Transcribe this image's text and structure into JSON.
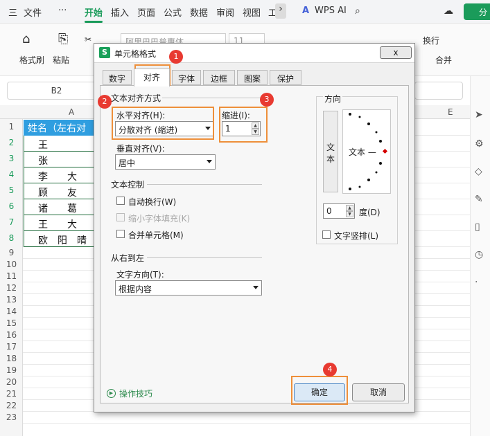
{
  "menu": {
    "hamburger": "三",
    "file": "文件",
    "more": "···",
    "tabs": [
      "开始",
      "插入",
      "页面",
      "公式",
      "数据",
      "审阅",
      "视图",
      "工"
    ],
    "wps_ai": "WPS AI",
    "share": "分"
  },
  "ribbon": {
    "format_painter": "格式刷",
    "paste": "粘贴",
    "font_name": "阿里巴巴普惠体",
    "font_size": "11",
    "wrap": "换行",
    "merge": "合并"
  },
  "namebox": "B2",
  "sheet": {
    "columns": [
      "A",
      "E"
    ],
    "rows": [
      "1",
      "2",
      "3",
      "4",
      "5",
      "6",
      "7",
      "8",
      "9",
      "10",
      "11",
      "12",
      "13",
      "14",
      "15",
      "16",
      "17",
      "18",
      "19",
      "20",
      "21",
      "22",
      "23"
    ],
    "header": "姓名（左右对",
    "names": [
      "王",
      "张",
      "李　　大",
      "顾　　友",
      "诸　　葛",
      "王　　大",
      "欧　阳　晴"
    ]
  },
  "dialog": {
    "logo": "S",
    "title": "单元格格式",
    "close": "x",
    "tabs": [
      "数字",
      "对齐",
      "字体",
      "边框",
      "图案",
      "保护"
    ],
    "align_section": "文本对齐方式",
    "h_align_label": "水平对齐(H):",
    "h_align_value": "分散对齐 (缩进)",
    "indent_label": "缩进(I):",
    "indent_value": "1",
    "v_align_label": "垂直对齐(V):",
    "v_align_value": "居中",
    "text_control": "文本控制",
    "wrap_text": "自动换行(W)",
    "shrink": "缩小字体填充(K)",
    "merge_cells": "合并单元格(M)",
    "rtl_section": "从右到左",
    "text_dir_label": "文字方向(T):",
    "text_dir_value": "根据内容",
    "orientation": "方向",
    "vertical_text": "文本",
    "dial_text": "文本 —",
    "degree_value": "0",
    "degree_label": "度(D)",
    "vertical_chk": "文字竖排(L)",
    "tips": "操作技巧",
    "ok": "确定",
    "cancel": "取消"
  },
  "badges": [
    "1",
    "2",
    "3",
    "4"
  ],
  "colors": {
    "accent": "#1a9b5a",
    "highlight": "#ee8f3a",
    "badge": "#e83a31",
    "header_fill": "#2f9ee0"
  }
}
